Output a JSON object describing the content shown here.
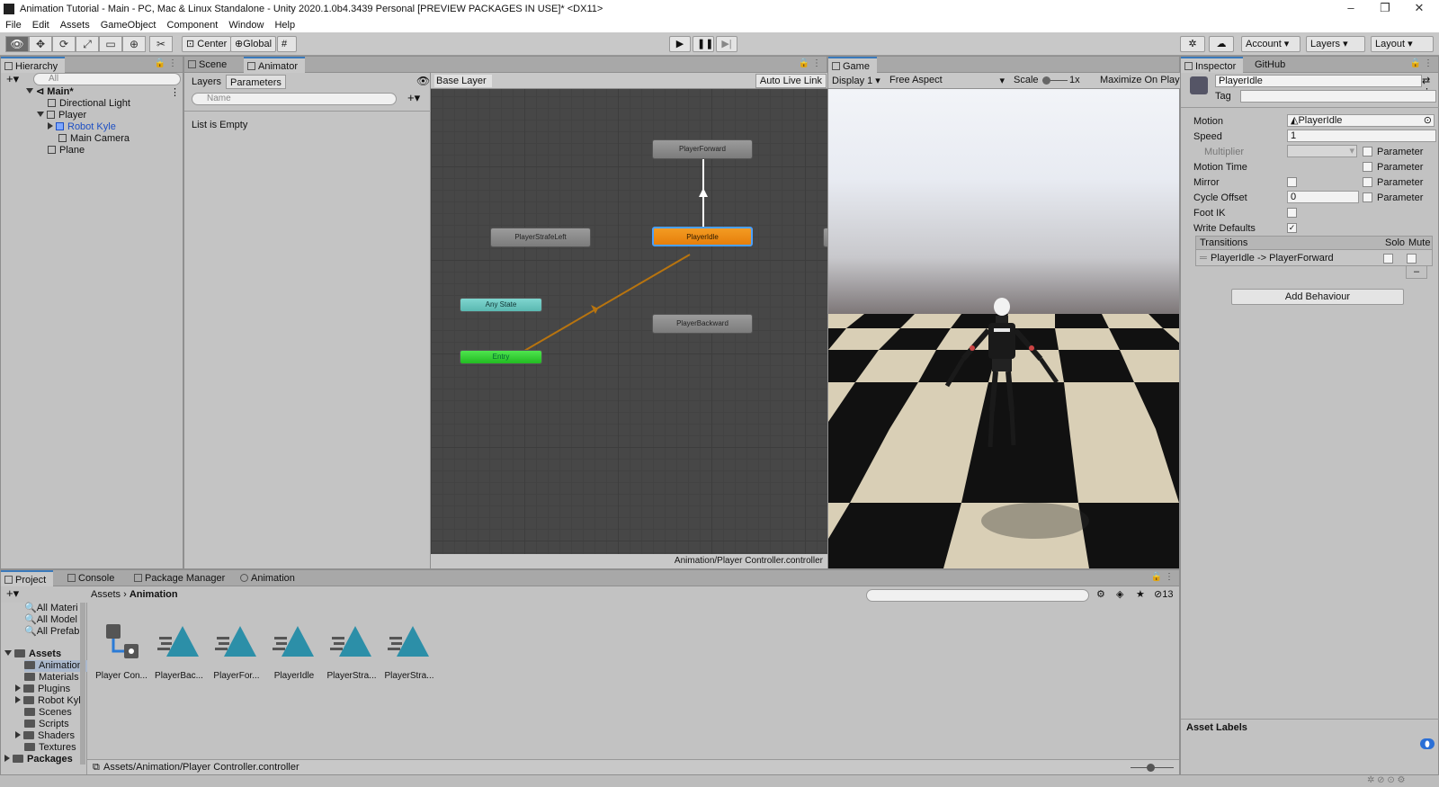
{
  "window": {
    "title": "Animation Tutorial - Main - PC, Mac & Linux Standalone - Unity 2020.1.0b4.3439 Personal [PREVIEW PACKAGES IN USE]* <DX11>"
  },
  "menu": [
    "File",
    "Edit",
    "Assets",
    "GameObject",
    "Component",
    "Window",
    "Help"
  ],
  "toolbar": {
    "pivot": "Center",
    "space": "Global",
    "account": "Account",
    "layers": "Layers",
    "layout": "Layout"
  },
  "hierarchy": {
    "tab": "Hierarchy",
    "search_placeholder": "All",
    "scene": "Main*",
    "items": [
      "Directional Light",
      "Player",
      "Robot Kyle",
      "Main Camera",
      "Plane"
    ]
  },
  "animator": {
    "tabs": [
      "Scene",
      "Animator"
    ],
    "subtabs": [
      "Layers",
      "Parameters"
    ],
    "param_search_placeholder": "Name",
    "list_empty": "List is Empty",
    "breadcrumb": "Base Layer",
    "auto_live_link": "Auto Live Link",
    "status_path": "Animation/Player Controller.controller",
    "nodes": {
      "forward": "PlayerForward",
      "strafe_left": "PlayerStrafeLeft",
      "idle": "PlayerIdle",
      "any_state": "Any State",
      "backward": "PlayerBackward",
      "entry": "Entry"
    }
  },
  "game": {
    "tab": "Game",
    "display": "Display 1",
    "aspect": "Free Aspect",
    "scale_label": "Scale",
    "scale_value": "1x",
    "maximize": "Maximize On Play"
  },
  "inspector": {
    "tabs": [
      "Inspector",
      "GitHub"
    ],
    "state_name": "PlayerIdle",
    "tag_label": "Tag",
    "motion_label": "Motion",
    "motion_value": "PlayerIdle",
    "speed_label": "Speed",
    "speed_value": "1",
    "multiplier_label": "Multiplier",
    "motion_time_label": "Motion Time",
    "mirror_label": "Mirror",
    "cycle_offset_label": "Cycle Offset",
    "cycle_offset_value": "0",
    "foot_ik_label": "Foot IK",
    "write_defaults_label": "Write Defaults",
    "parameter_label": "Parameter",
    "transitions_label": "Transitions",
    "solo_label": "Solo",
    "mute_label": "Mute",
    "transition_item": "PlayerIdle -> PlayerForward",
    "minus": "–",
    "add_behaviour": "Add Behaviour",
    "asset_labels": "Asset Labels"
  },
  "project": {
    "tabs": [
      "Project",
      "Console",
      "Package Manager",
      "Animation"
    ],
    "favorites": [
      "All Materi",
      "All Model",
      "All Prefab"
    ],
    "tree": {
      "assets": "Assets",
      "folders": [
        "Animation",
        "Materials",
        "Plugins",
        "Robot Kyl",
        "Scenes",
        "Scripts",
        "Shaders",
        "Textures"
      ],
      "packages": "Packages"
    },
    "breadcrumb": [
      "Assets",
      "Animation"
    ],
    "assets": [
      "Player Con...",
      "PlayerBac...",
      "PlayerFor...",
      "PlayerIdle",
      "PlayerStra...",
      "PlayerStra..."
    ],
    "hidden_count": "13",
    "status_path": "Assets/Animation/Player Controller.controller"
  }
}
